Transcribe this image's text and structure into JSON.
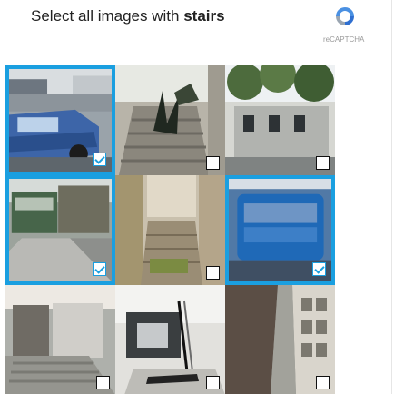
{
  "instruction": {
    "prefix": "Select all images with",
    "target": "stairs"
  },
  "branding": {
    "label": "reCAPTCHA",
    "accent": "#1a9fe0"
  },
  "tiles": [
    {
      "index": 1,
      "subject": "street with car",
      "selected": true
    },
    {
      "index": 2,
      "subject": "stone stairway with plant",
      "selected": false
    },
    {
      "index": 3,
      "subject": "building with trees",
      "selected": false
    },
    {
      "index": 4,
      "subject": "street with bus",
      "selected": true
    },
    {
      "index": 5,
      "subject": "stairway alley",
      "selected": false
    },
    {
      "index": 6,
      "subject": "blue bus",
      "selected": true
    },
    {
      "index": 7,
      "subject": "doorway steps",
      "selected": false
    },
    {
      "index": 8,
      "subject": "entrance with handrail",
      "selected": false
    },
    {
      "index": 9,
      "subject": "street perspective",
      "selected": false
    }
  ]
}
